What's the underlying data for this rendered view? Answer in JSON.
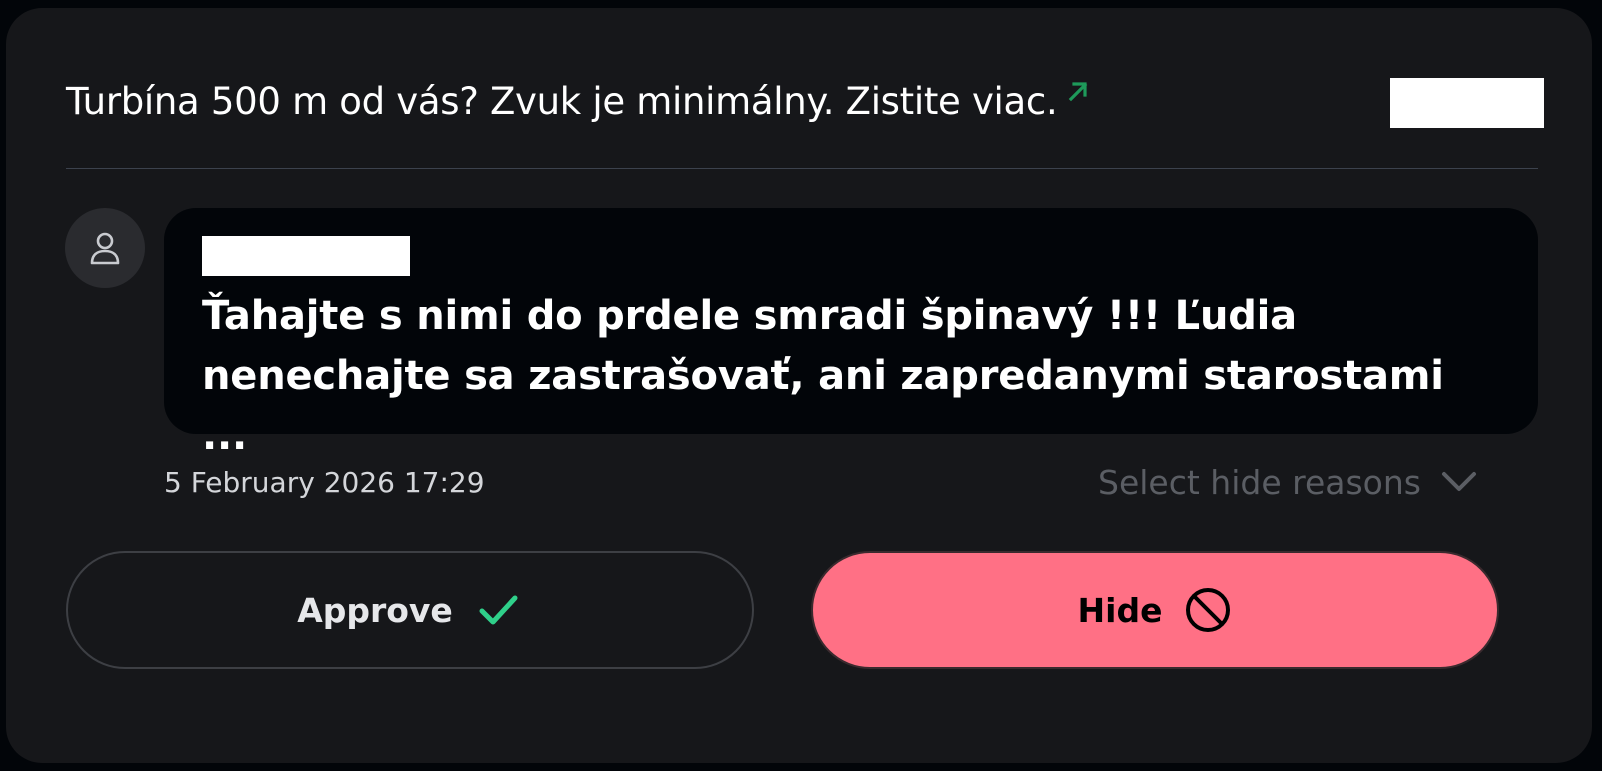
{
  "post": {
    "title": "Turbína 500 m od vás? Zvuk je minimálny. Zistite viac.",
    "link_icon": "external-link-arrow-icon"
  },
  "comment": {
    "avatar_icon": "user-icon",
    "text": "Ťahajte s nimi do prdele smradi špinavý !!! Ľudia nenechajte sa zastrašovať, ani zapredanymi starostami ...",
    "timestamp": "5 February 2026 17:29"
  },
  "moderation": {
    "hide_reasons_placeholder": "Select hide reasons",
    "approve_label": "Approve",
    "approve_icon": "checkmark-icon",
    "hide_label": "Hide",
    "hide_icon": "ban-icon"
  },
  "colors": {
    "page_background": "#020509",
    "card_background": "#16171a",
    "bubble_background": "#020509",
    "link_accent": "#1e9a5a",
    "approve_check": "#2fd08a",
    "hide_button": "#ff7085",
    "muted_text": "#5b5e64"
  }
}
